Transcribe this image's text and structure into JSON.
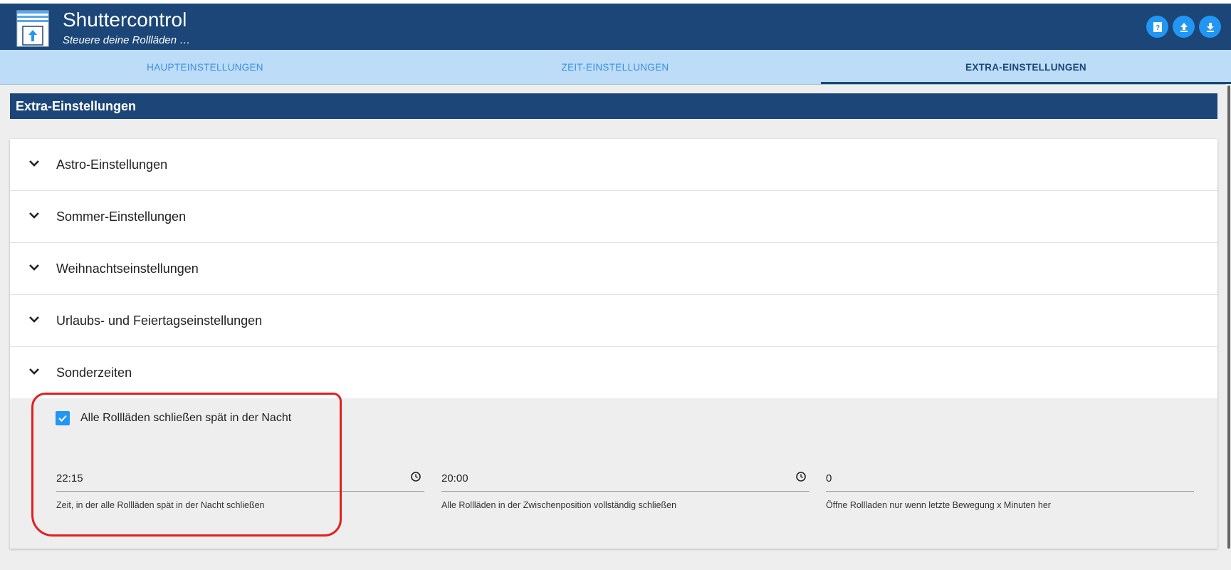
{
  "header": {
    "title": "Shuttercontrol",
    "subtitle": "Steuere deine Rollläden …",
    "logo_icon": "window-shutter-icon",
    "actions": [
      {
        "icon": "help-icon"
      },
      {
        "icon": "upload-icon"
      },
      {
        "icon": "download-icon"
      }
    ]
  },
  "tabs": [
    {
      "label": "HAUPTEINSTELLUNGEN",
      "active": false
    },
    {
      "label": "ZEIT-EINSTELLUNGEN",
      "active": false
    },
    {
      "label": "EXTRA-EINSTELLUNGEN",
      "active": true
    }
  ],
  "section_title": "Extra-Einstellungen",
  "panels": [
    {
      "title": "Astro-Einstellungen",
      "expanded": false
    },
    {
      "title": "Sommer-Einstellungen",
      "expanded": false
    },
    {
      "title": "Weihnachtseinstellungen",
      "expanded": false
    },
    {
      "title": "Urlaubs- und Feiertagseinstellungen",
      "expanded": false
    },
    {
      "title": "Sonderzeiten",
      "expanded": true
    }
  ],
  "sonderzeiten": {
    "checkbox": {
      "label": "Alle Rollläden schließen spät in der Nacht",
      "checked": true
    },
    "fields": [
      {
        "value": "22:15",
        "hint": "Zeit, in der alle Rollläden spät in der Nacht schließen",
        "icon": "clock-icon"
      },
      {
        "value": "20:00",
        "hint": "Alle Rollläden in der Zwischenposition vollständig schließen",
        "icon": "clock-icon"
      },
      {
        "value": "0",
        "hint": "Öffne Rollladen nur wenn letzte Bewegung x Minuten her"
      }
    ]
  },
  "colors": {
    "primary": "#1b4677",
    "tab_bar": "#bcdcf7",
    "accent": "#2196f3",
    "annotation": "#e1201f"
  }
}
